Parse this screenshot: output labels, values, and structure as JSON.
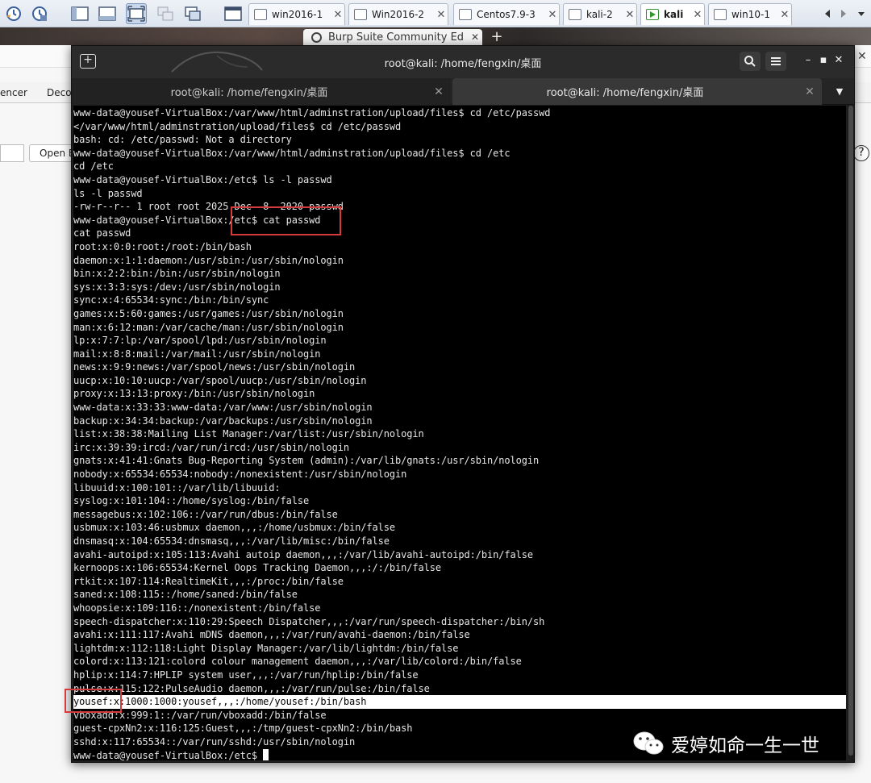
{
  "vm_toolbar": {
    "tabs": [
      {
        "label": "win2016-1",
        "active": false
      },
      {
        "label": "Win2016-2",
        "active": false
      },
      {
        "label": "Centos7.9-3",
        "active": false
      },
      {
        "label": "kali-2",
        "active": false
      },
      {
        "label": "kali",
        "active": true
      },
      {
        "label": "win10-1",
        "active": false
      }
    ],
    "close_glyph": "✕"
  },
  "browser": {
    "tab_title": "Burp Suite Community Ed",
    "tab_close": "✕",
    "new_tab": "+"
  },
  "burp": {
    "tab_partial_1": "encer",
    "tab_partial_2": "Deco",
    "open_button": "Open B",
    "help_glyph": "?",
    "side_close": "✕"
  },
  "terminal": {
    "window_title": "root@kali: /home/fengxin/桌面",
    "new_tab_glyph": "+",
    "search_glyph": "⌕",
    "menu_glyph": "≡",
    "minimize_glyph": "–",
    "maximize_glyph": "▪",
    "close_glyph": "✕",
    "tabs": [
      {
        "label": "root@kali: /home/fengxin/桌面",
        "active": false
      },
      {
        "label": "root@kali: /home/fengxin/桌面",
        "active": true
      }
    ],
    "tab_close": "✕",
    "dropdown_glyph": "▼",
    "lines": [
      "www-data@yousef-VirtualBox:/var/www/html/adminstration/upload/files$ cd /etc/passwd",
      "</var/www/html/adminstration/upload/files$ cd /etc/passwd",
      "bash: cd: /etc/passwd: Not a directory",
      "www-data@yousef-VirtualBox:/var/www/html/adminstration/upload/files$ cd /etc",
      "cd /etc",
      "www-data@yousef-VirtualBox:/etc$ ls -l passwd",
      "ls -l passwd",
      "-rw-r--r-- 1 root root 2025 Dec  8  2020 passwd",
      "www-data@yousef-VirtualBox:/etc$ cat passwd",
      "cat passwd",
      "root:x:0:0:root:/root:/bin/bash",
      "daemon:x:1:1:daemon:/usr/sbin:/usr/sbin/nologin",
      "bin:x:2:2:bin:/bin:/usr/sbin/nologin",
      "sys:x:3:3:sys:/dev:/usr/sbin/nologin",
      "sync:x:4:65534:sync:/bin:/bin/sync",
      "games:x:5:60:games:/usr/games:/usr/sbin/nologin",
      "man:x:6:12:man:/var/cache/man:/usr/sbin/nologin",
      "lp:x:7:7:lp:/var/spool/lpd:/usr/sbin/nologin",
      "mail:x:8:8:mail:/var/mail:/usr/sbin/nologin",
      "news:x:9:9:news:/var/spool/news:/usr/sbin/nologin",
      "uucp:x:10:10:uucp:/var/spool/uucp:/usr/sbin/nologin",
      "proxy:x:13:13:proxy:/bin:/usr/sbin/nologin",
      "www-data:x:33:33:www-data:/var/www:/usr/sbin/nologin",
      "backup:x:34:34:backup:/var/backups:/usr/sbin/nologin",
      "list:x:38:38:Mailing List Manager:/var/list:/usr/sbin/nologin",
      "irc:x:39:39:ircd:/var/run/ircd:/usr/sbin/nologin",
      "gnats:x:41:41:Gnats Bug-Reporting System (admin):/var/lib/gnats:/usr/sbin/nologin",
      "nobody:x:65534:65534:nobody:/nonexistent:/usr/sbin/nologin",
      "libuuid:x:100:101::/var/lib/libuuid:",
      "syslog:x:101:104::/home/syslog:/bin/false",
      "messagebus:x:102:106::/var/run/dbus:/bin/false",
      "usbmux:x:103:46:usbmux daemon,,,:/home/usbmux:/bin/false",
      "dnsmasq:x:104:65534:dnsmasq,,,:/var/lib/misc:/bin/false",
      "avahi-autoipd:x:105:113:Avahi autoip daemon,,,:/var/lib/avahi-autoipd:/bin/false",
      "kernoops:x:106:65534:Kernel Oops Tracking Daemon,,,:/:/bin/false",
      "rtkit:x:107:114:RealtimeKit,,,:/proc:/bin/false",
      "saned:x:108:115::/home/saned:/bin/false",
      "whoopsie:x:109:116::/nonexistent:/bin/false",
      "speech-dispatcher:x:110:29:Speech Dispatcher,,,:/var/run/speech-dispatcher:/bin/sh",
      "avahi:x:111:117:Avahi mDNS daemon,,,:/var/run/avahi-daemon:/bin/false",
      "lightdm:x:112:118:Light Display Manager:/var/lib/lightdm:/bin/false",
      "colord:x:113:121:colord colour management daemon,,,:/var/lib/colord:/bin/false",
      "hplip:x:114:7:HPLIP system user,,,:/var/run/hplip:/bin/false",
      "pulse:x:115:122:PulseAudio daemon,,,:/var/run/pulse:/bin/false",
      "yousef:x:1000:1000:yousef,,,:/home/yousef:/bin/bash",
      "vboxadd:x:999:1::/var/run/vboxadd:/bin/false",
      "guest-cpxNn2:x:116:125:Guest,,,:/tmp/guest-cpxNn2:/bin/bash",
      "sshd:x:117:65534::/var/run/sshd:/usr/sbin/nologin",
      "www-data@yousef-VirtualBox:/etc$ "
    ],
    "highlighted_line": 44
  },
  "watermark": {
    "text": "爱婷如命一生一世",
    "icon": "wechat-icon"
  },
  "colors": {
    "terminal_bg": "#000000",
    "terminal_fg": "#e6e6e6",
    "annotation": "#d63a3a",
    "highlight_bg": "#ffffff"
  }
}
